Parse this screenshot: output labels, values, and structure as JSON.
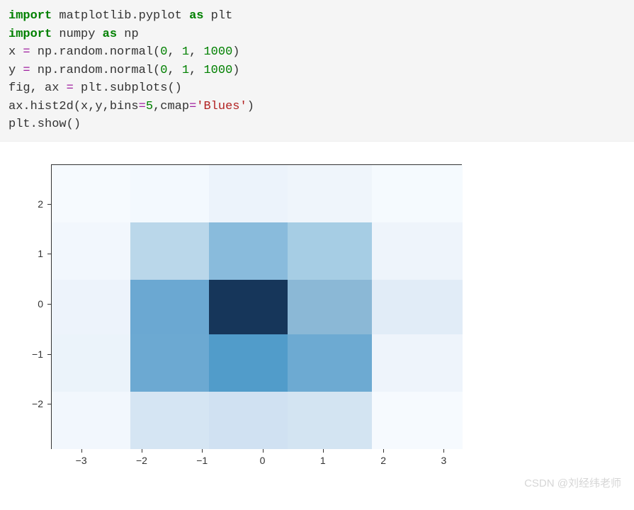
{
  "code": {
    "l1_import": "import",
    "l1_mod": "matplotlib.pyplot",
    "l1_as": "as",
    "l1_alias": "plt",
    "l2_import": "import",
    "l2_mod": "numpy",
    "l2_as": "as",
    "l2_alias": "np",
    "l3_var": "x ",
    "l3_eq": "=",
    "l3_expr": " np.random.normal(",
    "l3_a": "0",
    "l3_c1": ", ",
    "l3_b": "1",
    "l3_c2": ", ",
    "l3_c": "1000",
    "l3_end": ")",
    "l4_var": "y ",
    "l4_eq": "=",
    "l4_expr": " np.random.normal(",
    "l4_a": "0",
    "l4_c1": ", ",
    "l4_b": "1",
    "l4_c2": ", ",
    "l4_c": "1000",
    "l4_end": ")",
    "l5_left": "fig, ax ",
    "l5_eq": "=",
    "l5_right": " plt.subplots()",
    "l6_a": "ax.hist2d(x,y,bins",
    "l6_eq": "=",
    "l6_b": "5",
    "l6_c": ",cmap",
    "l6_eq2": "=",
    "l6_str": "'Blues'",
    "l6_end": ")",
    "l7": "plt.show()"
  },
  "chart_data": {
    "type": "heatmap",
    "title": "",
    "xlabel": "",
    "ylabel": "",
    "x_ticks": [
      "-3",
      "-2",
      "-1",
      "0",
      "1",
      "2",
      "3"
    ],
    "y_ticks": [
      "-2",
      "-1",
      "0",
      "1",
      "2"
    ],
    "x_range": [
      -3.5,
      3.3
    ],
    "y_range": [
      -2.9,
      2.8
    ],
    "x_edges": [
      -3.5,
      -2.2,
      -0.9,
      0.4,
      1.8,
      3.3
    ],
    "y_edges": [
      -2.9,
      -1.75,
      -0.6,
      0.5,
      1.65,
      2.8
    ],
    "grid": [
      [
        9,
        16,
        15,
        9,
        4
      ],
      [
        27,
        90,
        92,
        37,
        8
      ],
      [
        30,
        105,
        145,
        78,
        16
      ],
      [
        28,
        89,
        75,
        48,
        14
      ],
      [
        5,
        15,
        23,
        15,
        7
      ]
    ],
    "grid_note": "rows are x-bin index left→right, cols are y-bin index bottom→top",
    "colors": [
      [
        "#f2f7fd",
        "#ebf3fa",
        "#edf3fb",
        "#f2f7fd",
        "#f6fafe"
      ],
      [
        "#d5e5f3",
        "#6ca9d2",
        "#6ba8d2",
        "#bad7ea",
        "#f3f9fe"
      ],
      [
        "#d0e1f2",
        "#519cca",
        "#16365a",
        "#89bbdc",
        "#ecf3fb"
      ],
      [
        "#d3e4f2",
        "#6daad2",
        "#8bb8d6",
        "#a6cde4",
        "#eff5fb"
      ],
      [
        "#f6fafe",
        "#eef4fb",
        "#e1ecf7",
        "#eef4fb",
        "#f5fafe"
      ]
    ],
    "cmap": "Blues"
  },
  "watermark": "CSDN @刘经纬老师"
}
